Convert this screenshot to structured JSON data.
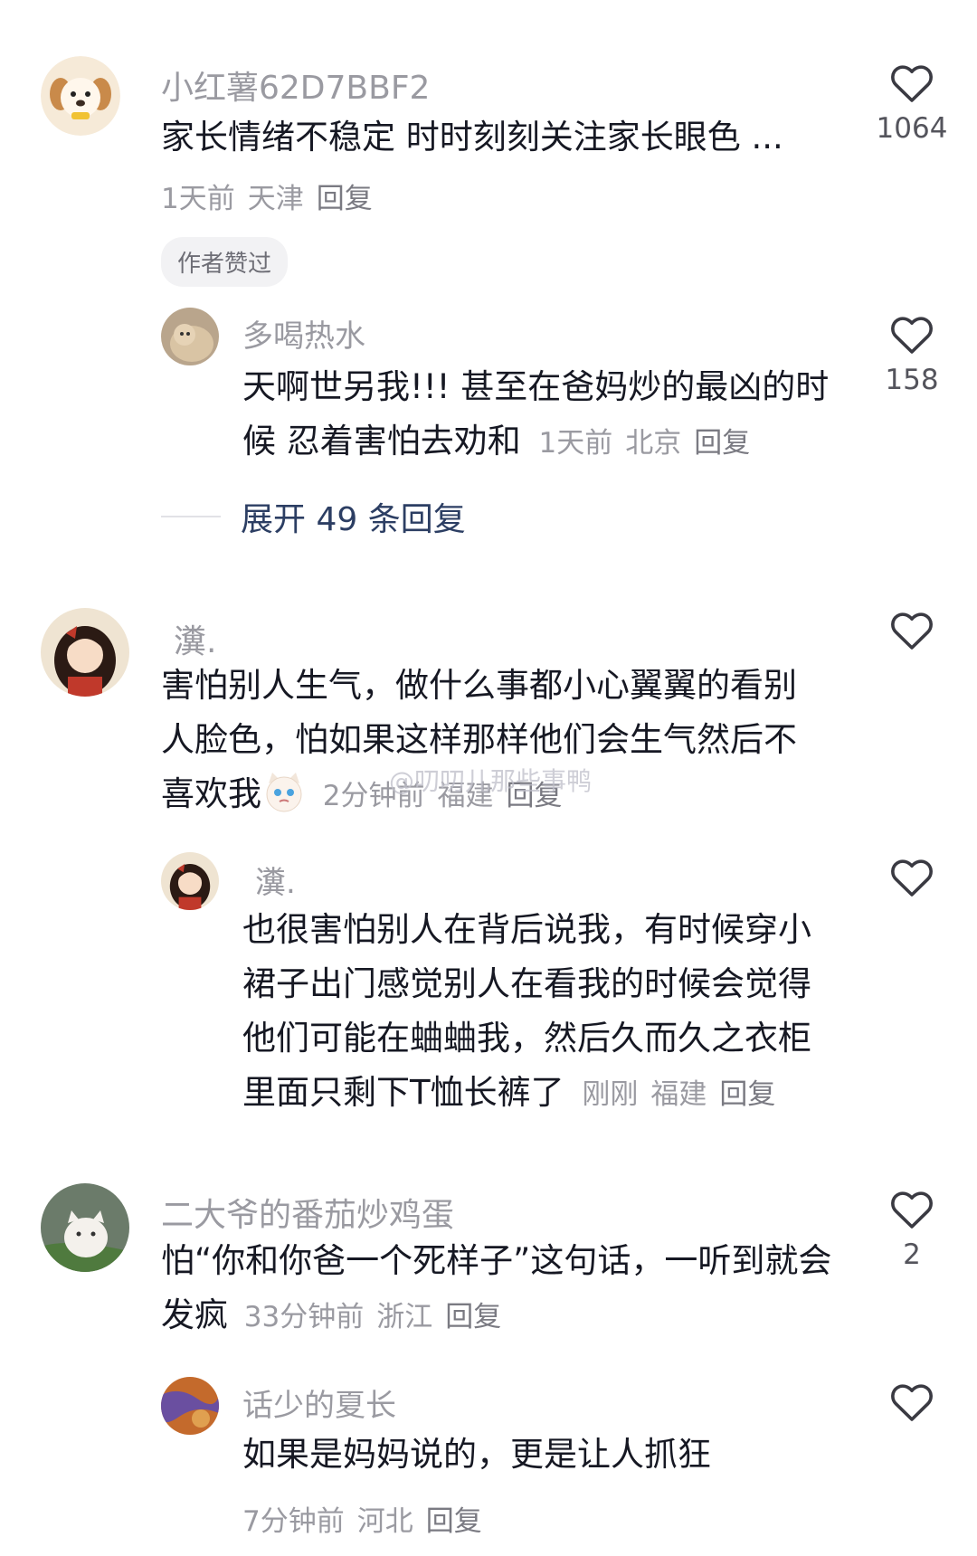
{
  "comments": [
    {
      "username": "小红薯62D7BBF2",
      "text": "家长情绪不稳定  时时刻刻关注家长眼色 ...",
      "time": "1天前",
      "location": "天津",
      "reply_label": "回复",
      "badge": "作者赞过",
      "likes": "1064",
      "replies": [
        {
          "username": "多喝热水",
          "text": "天啊世另我!!! 甚至在爸妈炒的最凶的时候 忍着害怕去劝和",
          "time": "1天前",
          "location": "北京",
          "reply_label": "回复",
          "likes": "158"
        }
      ],
      "expand_label": "展开 49 条回复"
    },
    {
      "username": "瀵.",
      "text": "害怕别人生气，做什么事都小心翼翼的看别人脸色，怕如果这样那样他们会生气然后不喜欢我",
      "time": "2分钟前",
      "location": "福建",
      "reply_label": "回复",
      "likes": "",
      "replies": [
        {
          "username": "瀵.",
          "text": "也很害怕别人在背后说我，有时候穿小裙子出门感觉别人在看我的时候会觉得他们可能在蛐蛐我，然后久而久之衣柜里面只剩下T恤长裤了",
          "time": "刚刚",
          "location": "福建",
          "reply_label": "回复",
          "likes": ""
        }
      ]
    },
    {
      "username": "二大爷的番茄炒鸡蛋",
      "text": "怕“你和你爸一个死样子”这句话，一听到就会发疯",
      "time": "33分钟前",
      "location": "浙江",
      "reply_label": "回复",
      "likes": "2",
      "replies": [
        {
          "username": "话少的夏长",
          "text": "如果是妈妈说的，更是让人抓狂",
          "time": "7分钟前",
          "location": "河北",
          "reply_label": "回复",
          "likes": ""
        }
      ]
    }
  ],
  "watermark": "@叨叨儿那些事鸭",
  "icons": {
    "like": "heart-outline-icon",
    "emoji": "crying-cat-emoji-icon"
  },
  "colors": {
    "text": "#161823",
    "secondary": "#9a9aa1",
    "link": "#2c3e63"
  }
}
